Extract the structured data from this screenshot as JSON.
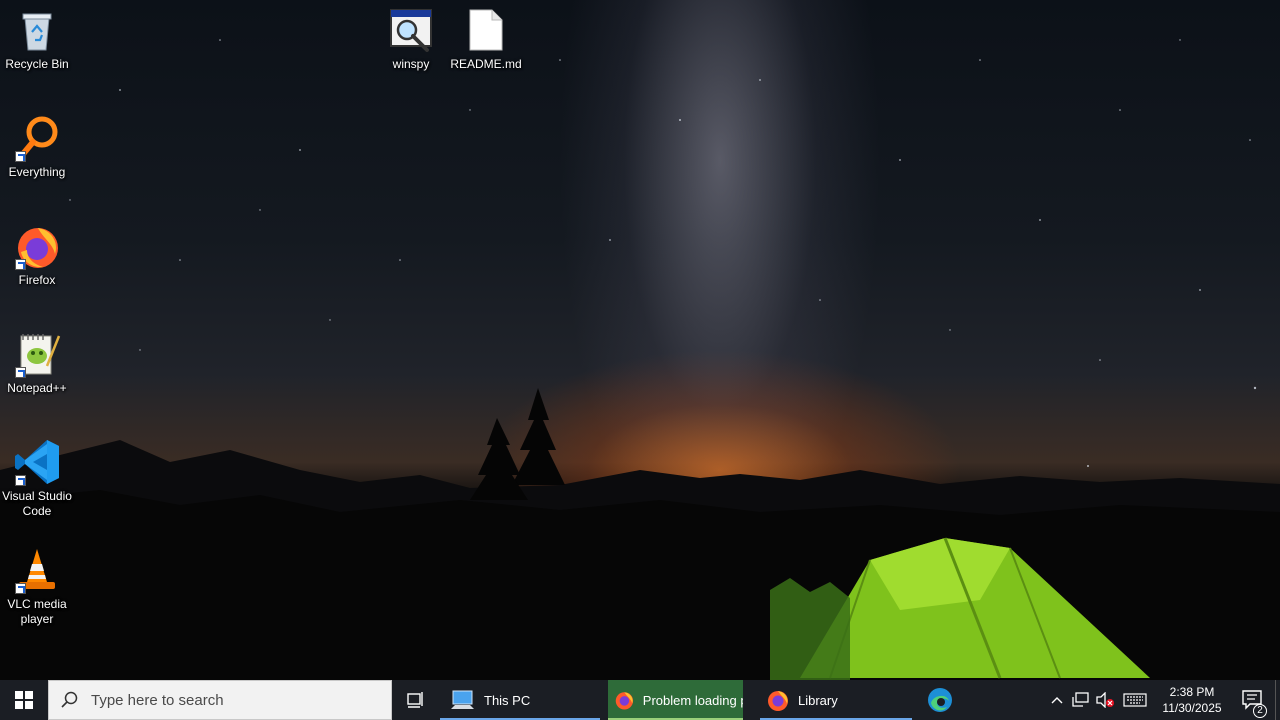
{
  "desktop": {
    "icons": [
      {
        "label": "Recycle Bin",
        "icon": "recycle-bin-icon"
      },
      {
        "label": "Everything",
        "icon": "everything-search-icon"
      },
      {
        "label": "Firefox",
        "icon": "firefox-icon"
      },
      {
        "label": "Notepad++",
        "icon": "notepad-plus-plus-icon"
      },
      {
        "label": "Visual Studio Code",
        "icon": "vscode-icon"
      },
      {
        "label": "VLC media player",
        "icon": "vlc-icon"
      },
      {
        "label": "winspy",
        "icon": "winspy-icon"
      },
      {
        "label": "README.md",
        "icon": "document-file-icon"
      }
    ]
  },
  "taskbar": {
    "search_placeholder": "Type here to search",
    "apps": [
      {
        "label": "This PC",
        "icon": "this-pc-icon"
      },
      {
        "label": "Problem loading p...",
        "icon": "firefox-icon"
      },
      {
        "label": "Library",
        "icon": "firefox-icon"
      },
      {
        "label": "",
        "icon": "edge-icon"
      }
    ],
    "clock": {
      "time": "2:38 PM",
      "date": "11/30/2025"
    },
    "notification_count": "2"
  },
  "colors": {
    "taskbar_bg": "#1b1e24",
    "active_task_bg": "#2e6b39",
    "running_indicator": "#6aa6e8"
  }
}
